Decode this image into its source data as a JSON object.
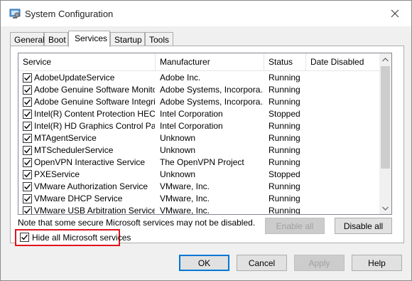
{
  "window": {
    "title": "System Configuration"
  },
  "tabs": [
    {
      "label": "General"
    },
    {
      "label": "Boot"
    },
    {
      "label": "Services"
    },
    {
      "label": "Startup"
    },
    {
      "label": "Tools"
    }
  ],
  "columns": {
    "service": "Service",
    "manufacturer": "Manufacturer",
    "status": "Status",
    "date_disabled": "Date Disabled"
  },
  "services": [
    {
      "name": "AdobeUpdateService",
      "manufacturer": "Adobe Inc.",
      "status": "Running",
      "date_disabled": ""
    },
    {
      "name": "Adobe Genuine Software Monito...",
      "manufacturer": "Adobe Systems, Incorpora...",
      "status": "Running",
      "date_disabled": ""
    },
    {
      "name": "Adobe Genuine Software Integri...",
      "manufacturer": "Adobe Systems, Incorpora...",
      "status": "Running",
      "date_disabled": ""
    },
    {
      "name": "Intel(R) Content Protection HEC...",
      "manufacturer": "Intel Corporation",
      "status": "Stopped",
      "date_disabled": ""
    },
    {
      "name": "Intel(R) HD Graphics Control Pa...",
      "manufacturer": "Intel Corporation",
      "status": "Running",
      "date_disabled": ""
    },
    {
      "name": "MTAgentService",
      "manufacturer": "Unknown",
      "status": "Running",
      "date_disabled": ""
    },
    {
      "name": "MTSchedulerService",
      "manufacturer": "Unknown",
      "status": "Running",
      "date_disabled": ""
    },
    {
      "name": "OpenVPN Interactive Service",
      "manufacturer": "The OpenVPN Project",
      "status": "Running",
      "date_disabled": ""
    },
    {
      "name": "PXEService",
      "manufacturer": "Unknown",
      "status": "Stopped",
      "date_disabled": ""
    },
    {
      "name": "VMware Authorization Service",
      "manufacturer": "VMware, Inc.",
      "status": "Running",
      "date_disabled": ""
    },
    {
      "name": "VMware DHCP Service",
      "manufacturer": "VMware, Inc.",
      "status": "Running",
      "date_disabled": ""
    },
    {
      "name": "VMware USB Arbitration Service",
      "manufacturer": "VMware, Inc.",
      "status": "Running",
      "date_disabled": ""
    }
  ],
  "note": "Note that some secure Microsoft services may not be disabled.",
  "buttons": {
    "enable_all": "Enable all",
    "disable_all": "Disable all",
    "ok": "OK",
    "cancel": "Cancel",
    "apply": "Apply",
    "help": "Help"
  },
  "hide_ms": {
    "label": "Hide all Microsoft services",
    "checked": true
  },
  "icons": {
    "app": "system-config-icon",
    "close": "close-icon"
  },
  "colors": {
    "highlight_border": "#e0141e",
    "focus_border": "#0078d7"
  }
}
